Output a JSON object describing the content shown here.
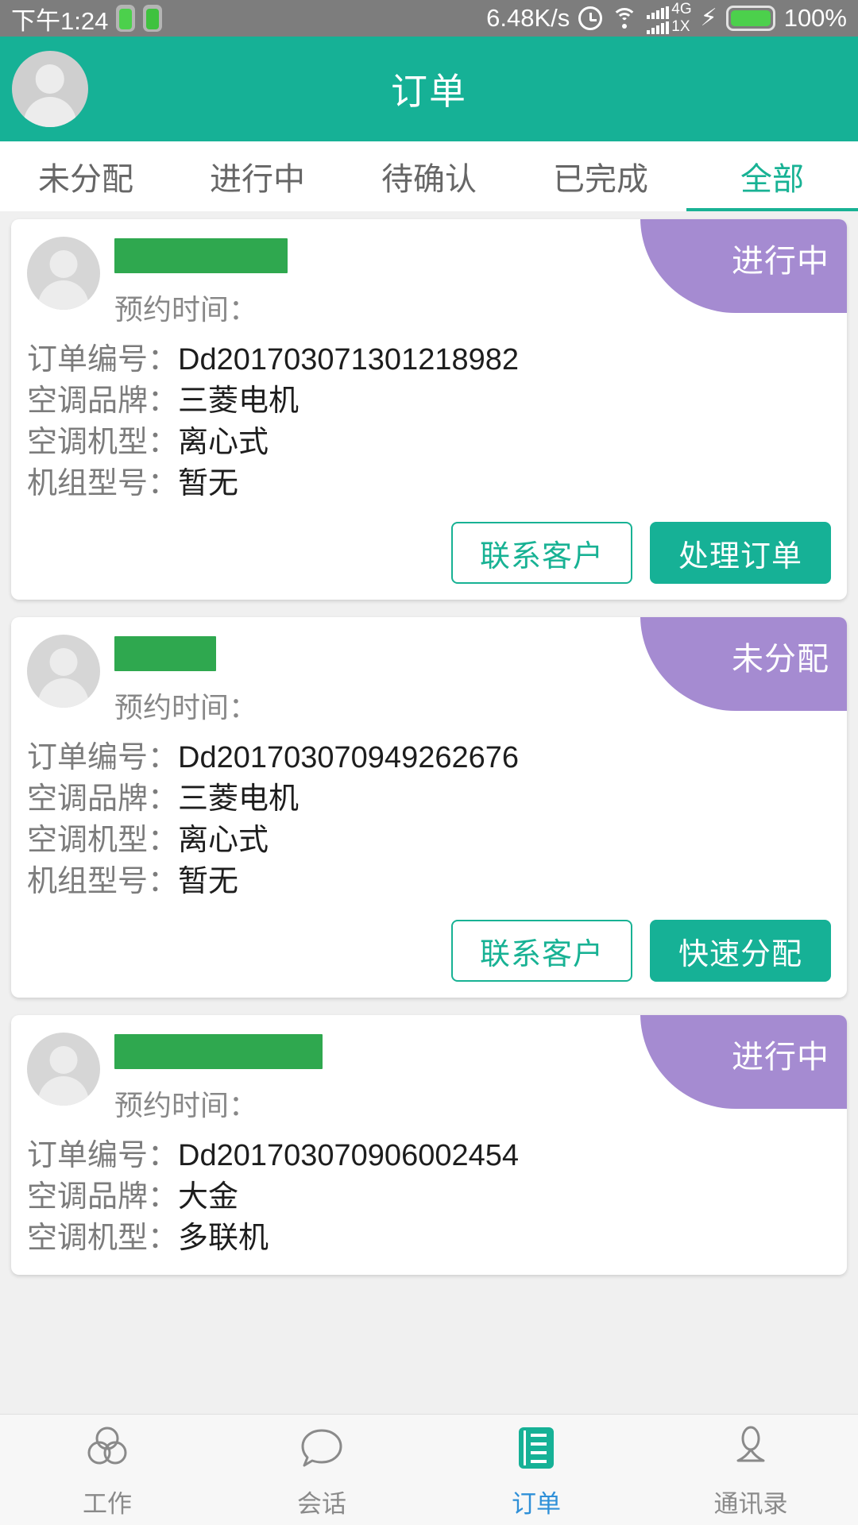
{
  "statusbar": {
    "time": "下午1:24",
    "battery_icon": "battery-icon",
    "android_icon": "android-icon",
    "network_speed": "6.48K/s",
    "alarm_icon": "alarm-icon",
    "wifi_icon": "wifi-icon",
    "signal_icon": "signal-bars-icon",
    "net_type_primary": "4G",
    "net_type_secondary": "1X",
    "charging_icon": "bolt-icon",
    "battery_level": "100%"
  },
  "header": {
    "title": "订单",
    "avatar_icon": "user-avatar-icon"
  },
  "tabs": [
    {
      "label": "未分配",
      "active": false
    },
    {
      "label": "进行中",
      "active": false
    },
    {
      "label": "待确认",
      "active": false
    },
    {
      "label": "已完成",
      "active": false
    },
    {
      "label": "全部",
      "active": true
    }
  ],
  "labels": {
    "appointment_time": "预约时间：",
    "order_no": "订单编号：",
    "brand": "空调品牌：",
    "model_type": "空调机型：",
    "unit_model": "机组型号："
  },
  "orders": [
    {
      "status_badge": "进行中",
      "customer_name_redacted": "",
      "appointment_time": "",
      "order_no": "Dd201703071301218982",
      "brand": "三菱电机",
      "model_type": "离心式",
      "unit_model": "暂无",
      "buttons": {
        "secondary": "联系客户",
        "primary": "处理订单"
      }
    },
    {
      "status_badge": "未分配",
      "customer_name_redacted": "",
      "appointment_time": "",
      "order_no": "Dd201703070949262676",
      "brand": "三菱电机",
      "model_type": "离心式",
      "unit_model": "暂无",
      "buttons": {
        "secondary": "联系客户",
        "primary": "快速分配"
      }
    },
    {
      "status_badge": "进行中",
      "customer_name_redacted": "",
      "appointment_time": "",
      "order_no": "Dd201703070906002454",
      "brand": "大金",
      "model_type": "多联机",
      "unit_model": "",
      "buttons": {
        "secondary": "",
        "primary": ""
      }
    }
  ],
  "bottom_nav": [
    {
      "label": "工作",
      "icon": "venn-circles-icon",
      "active": false
    },
    {
      "label": "会话",
      "icon": "chat-bubble-icon",
      "active": false
    },
    {
      "label": "订单",
      "icon": "order-list-icon",
      "active": true
    },
    {
      "label": "通讯录",
      "icon": "contacts-person-icon",
      "active": false
    }
  ],
  "colors": {
    "brand_teal": "#16b196",
    "badge_purple": "#a58bd1",
    "redact_green": "#2fa84f",
    "active_nav_blue": "#2f90d8",
    "statusbar_gray": "#7d7d7d"
  }
}
